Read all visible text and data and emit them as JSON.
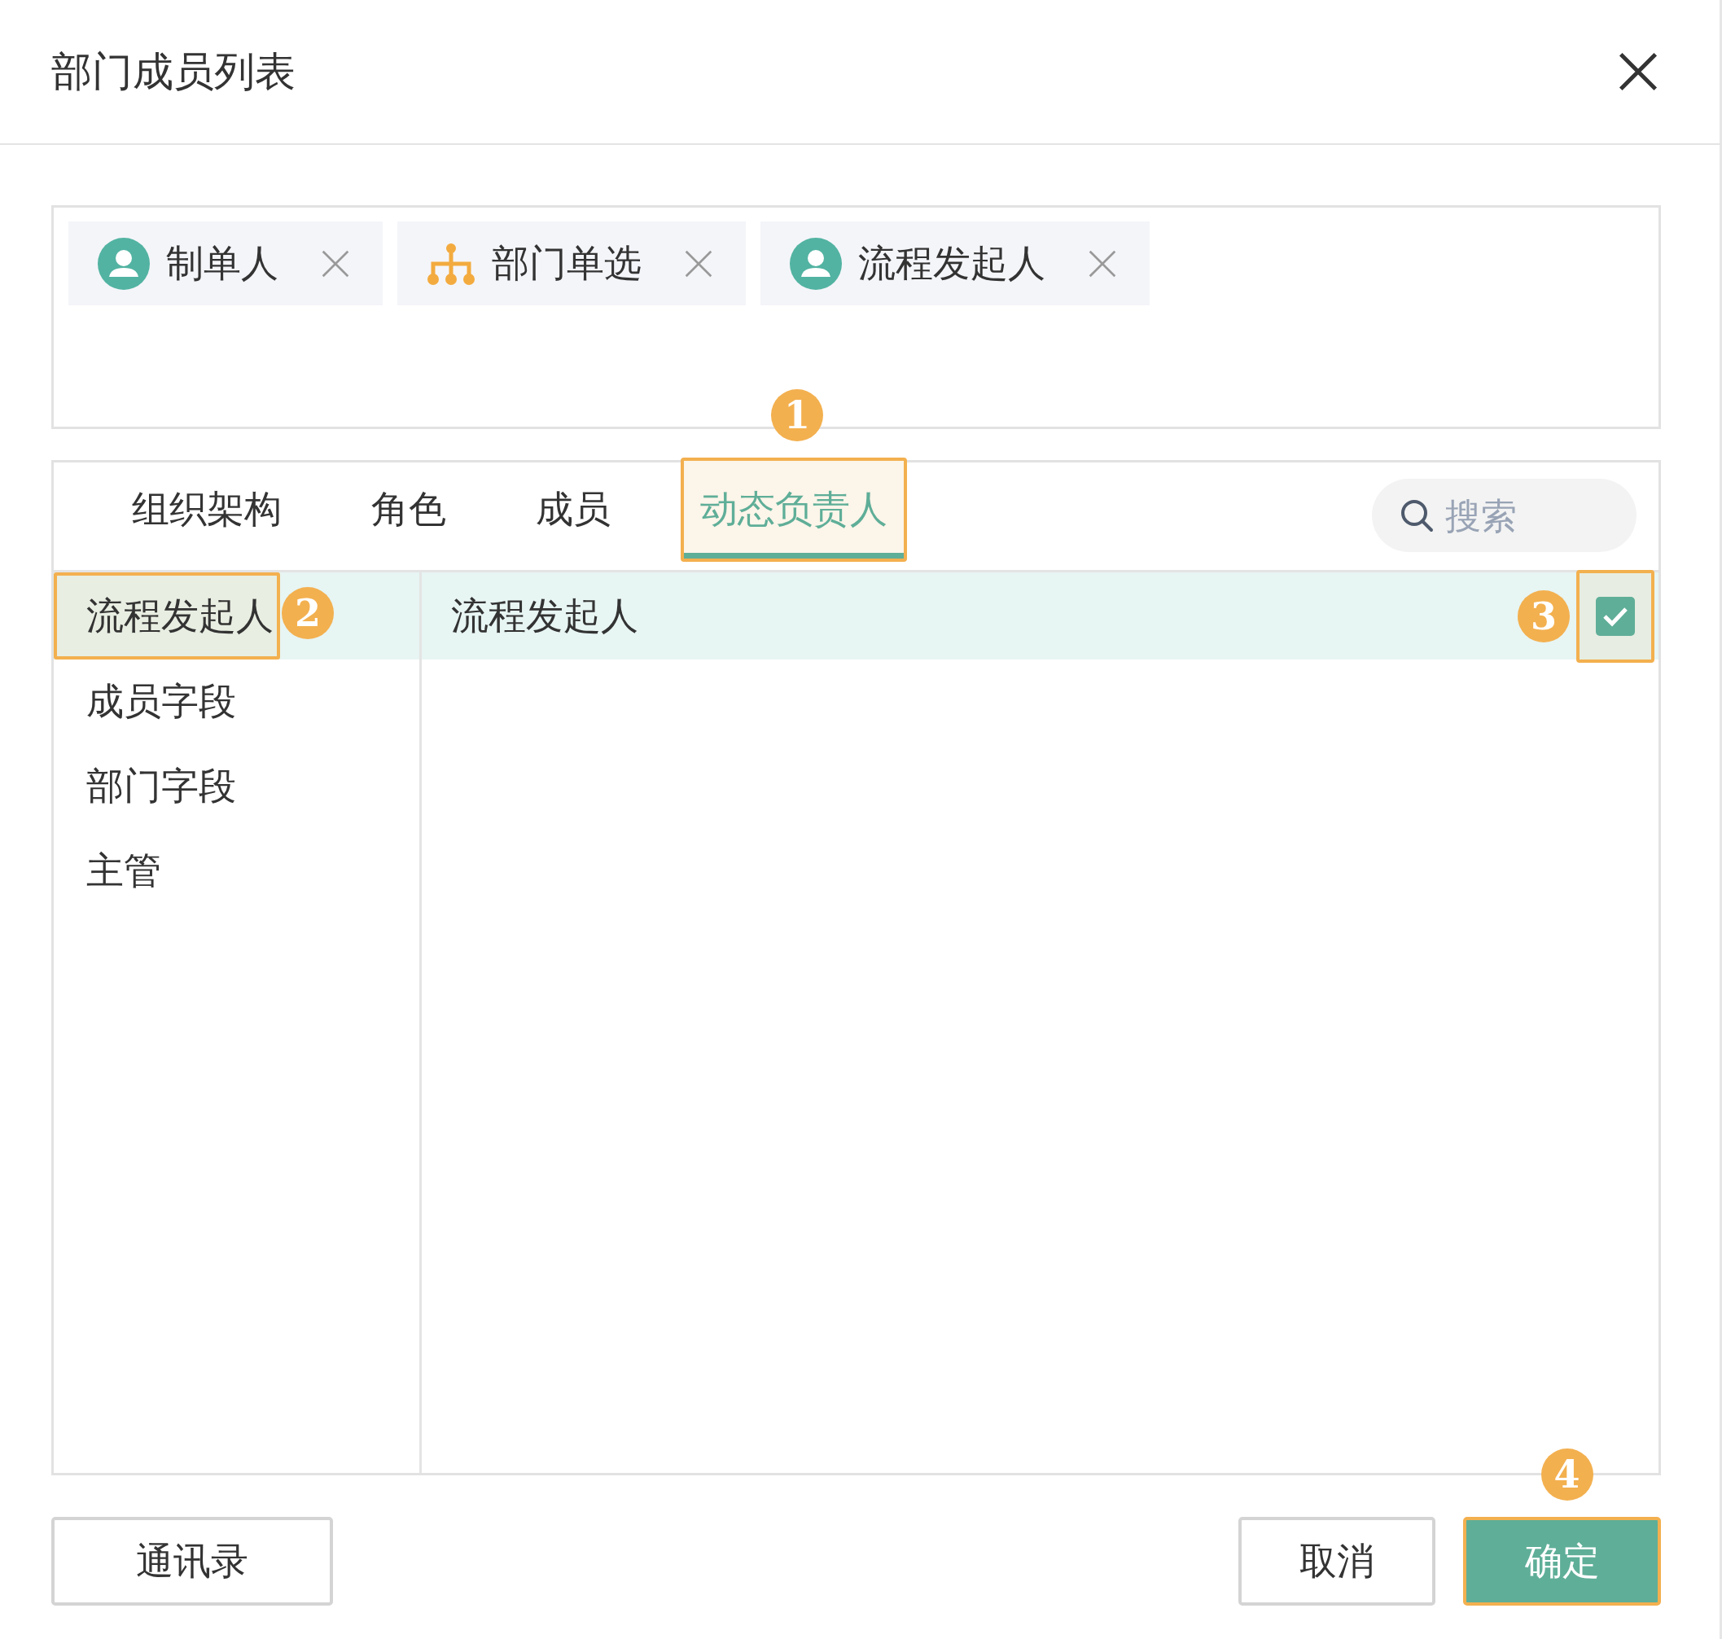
{
  "dialog": {
    "title": "部门成员列表"
  },
  "selected_tags": [
    {
      "label": "制单人",
      "kind": "user"
    },
    {
      "label": "部门单选",
      "kind": "department"
    },
    {
      "label": "流程发起人",
      "kind": "user"
    }
  ],
  "tabs": [
    {
      "label": "组织架构",
      "selected": false
    },
    {
      "label": "角色",
      "selected": false
    },
    {
      "label": "成员",
      "selected": false
    },
    {
      "label": "动态负责人",
      "selected": true,
      "callout": "1"
    }
  ],
  "search": {
    "placeholder": "搜索"
  },
  "categories": [
    {
      "label": "流程发起人",
      "selected": true,
      "callout": "2"
    },
    {
      "label": "成员字段",
      "selected": false
    },
    {
      "label": "部门字段",
      "selected": false
    },
    {
      "label": "主管",
      "selected": false
    }
  ],
  "options": [
    {
      "label": "流程发起人",
      "checked": true,
      "callout": "3"
    }
  ],
  "footer": {
    "left_button": {
      "label": "通讯录"
    },
    "buttons": [
      {
        "label": "取消",
        "kind": "secondary"
      },
      {
        "label": "确定",
        "kind": "primary",
        "callout": "4"
      }
    ]
  }
}
